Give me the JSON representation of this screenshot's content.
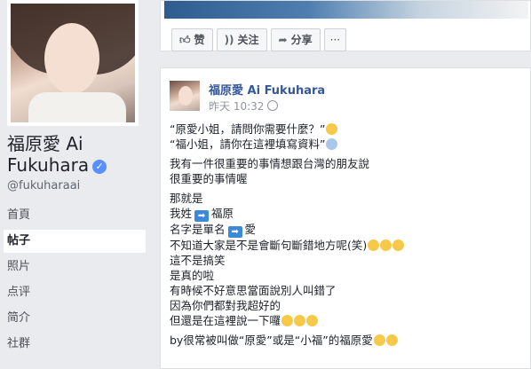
{
  "sidebar": {
    "page_name": "福原愛 Ai Fukuhara",
    "handle": "@fukuharaai",
    "nav_items": [
      "首頁",
      "帖子",
      "照片",
      "点评",
      "简介",
      "社群"
    ],
    "active_item": "帖子"
  },
  "top_actions": {
    "like": "赞",
    "follow": "关注",
    "share": "分享",
    "more": "···"
  },
  "post": {
    "author": "福原愛 Ai Fukuhara",
    "time": "昨天 10:32",
    "lines": {
      "l1": "“原愛小姐，請問你需要什麼？”",
      "l2": "“福小姐，請你在這裡填寫資料”",
      "l3": "我有一件很重要的事情想跟台灣的朋友說",
      "l4": "很重要的事情喔",
      "l5": "那就是",
      "l6a": "我姓",
      "l6b": "福原",
      "l7a": "名字是單名",
      "l7b": "愛",
      "l8": "不知道大家是不是會斷句斷錯地方呢(笑)",
      "l9": "這不是搞笑",
      "l10": "是真的啦",
      "l11": "有時候不好意思當面說別人叫錯了",
      "l12": "因為你們都對我超好的",
      "l13": "但還是在這裡說一下囉",
      "l14": "by很常被叫做“原愛”或是“小福”的福原愛"
    }
  },
  "icons": {
    "like": "thumbs-up-icon",
    "follow": "rss-icon",
    "share": "share-arrow-icon",
    "verified": "verified-badge-icon",
    "arrow": "right-arrow-emoji-icon"
  },
  "colors": {
    "link": "#365899",
    "verified": "#5890ff",
    "page_bg": "#e9ebee"
  }
}
